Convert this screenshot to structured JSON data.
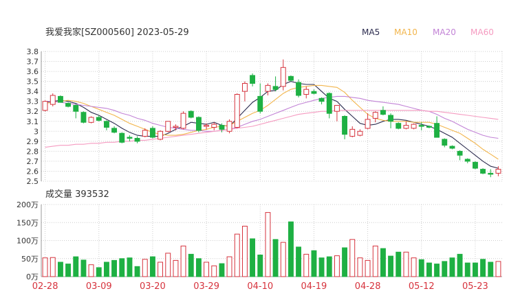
{
  "chart_data": {
    "type": "candlestick",
    "title": "我爱我家[SZ000560] 2023-05-29",
    "legend": [
      {
        "name": "MA5",
        "color": "#2b2b4e"
      },
      {
        "name": "MA10",
        "color": "#f2b54c"
      },
      {
        "name": "MA20",
        "color": "#c283d6"
      },
      {
        "name": "MA60",
        "color": "#f59ac0"
      }
    ],
    "colors": {
      "up": "#d6323c",
      "down": "#1eb043",
      "grid": "#cccccc",
      "axis": "#999999"
    },
    "price_axis": {
      "ylim": [
        2.5,
        3.8
      ],
      "ticks": [
        "3.8",
        "3.7",
        "3.6",
        "3.5",
        "3.4",
        "3.3",
        "3.2",
        "3.1",
        "3",
        "2.9",
        "2.8",
        "2.7",
        "2.6",
        "2.5"
      ]
    },
    "volume_panel": {
      "label": "成交量 393532",
      "ylim": [
        0,
        200
      ],
      "ticks": [
        "200万",
        "150万",
        "100万",
        "50万",
        "0万"
      ]
    },
    "x_ticks": [
      {
        "label": "02-28",
        "index": 0
      },
      {
        "label": "03-09",
        "index": 7
      },
      {
        "label": "03-20",
        "index": 14
      },
      {
        "label": "03-29",
        "index": 21
      },
      {
        "label": "04-10",
        "index": 28
      },
      {
        "label": "04-19",
        "index": 35
      },
      {
        "label": "04-28",
        "index": 42
      },
      {
        "label": "05-12",
        "index": 49
      },
      {
        "label": "05-23",
        "index": 56
      }
    ],
    "ohlc": [
      [
        3.21,
        3.31,
        3.2,
        3.3
      ],
      [
        3.27,
        3.38,
        3.25,
        3.36
      ],
      [
        3.35,
        3.36,
        3.29,
        3.29
      ],
      [
        3.28,
        3.29,
        3.24,
        3.25
      ],
      [
        3.26,
        3.27,
        3.13,
        3.2
      ],
      [
        3.19,
        3.2,
        3.08,
        3.09
      ],
      [
        3.09,
        3.15,
        3.08,
        3.14
      ],
      [
        3.14,
        3.16,
        3.1,
        3.11
      ],
      [
        3.1,
        3.11,
        3.01,
        3.04
      ],
      [
        3.03,
        3.05,
        2.98,
        2.99
      ],
      [
        2.98,
        2.99,
        2.88,
        2.89
      ],
      [
        2.94,
        2.96,
        2.9,
        2.93
      ],
      [
        2.93,
        2.95,
        2.88,
        2.9
      ],
      [
        2.95,
        3.03,
        2.94,
        3.01
      ],
      [
        3.03,
        3.05,
        2.93,
        2.94
      ],
      [
        2.92,
        3.01,
        2.91,
        3.0
      ],
      [
        3.0,
        3.1,
        2.99,
        3.1
      ],
      [
        3.04,
        3.07,
        3.01,
        3.05
      ],
      [
        3.03,
        3.2,
        3.02,
        3.18
      ],
      [
        3.2,
        3.21,
        3.13,
        3.14
      ],
      [
        3.14,
        3.15,
        2.99,
        3.01
      ],
      [
        3.05,
        3.08,
        3.02,
        3.06
      ],
      [
        3.04,
        3.09,
        3.01,
        3.07
      ],
      [
        3.06,
        3.08,
        2.99,
        3.02
      ],
      [
        3.0,
        3.12,
        2.98,
        3.1
      ],
      [
        3.04,
        3.38,
        3.03,
        3.37
      ],
      [
        3.4,
        3.5,
        3.3,
        3.48
      ],
      [
        3.56,
        3.58,
        3.45,
        3.48
      ],
      [
        3.35,
        3.48,
        3.18,
        3.2
      ],
      [
        3.4,
        3.48,
        3.36,
        3.46
      ],
      [
        3.45,
        3.55,
        3.4,
        3.42
      ],
      [
        3.45,
        3.72,
        3.41,
        3.64
      ],
      [
        3.55,
        3.56,
        3.5,
        3.51
      ],
      [
        3.49,
        3.52,
        3.34,
        3.36
      ],
      [
        3.37,
        3.45,
        3.33,
        3.42
      ],
      [
        3.4,
        3.42,
        3.37,
        3.38
      ],
      [
        3.33,
        3.34,
        3.27,
        3.3
      ],
      [
        3.38,
        3.39,
        3.13,
        3.18
      ],
      [
        3.2,
        3.26,
        3.1,
        3.26
      ],
      [
        3.15,
        3.16,
        2.92,
        2.97
      ],
      [
        2.95,
        3.05,
        2.94,
        3.02
      ],
      [
        2.96,
        3.02,
        2.95,
        3.0
      ],
      [
        3.03,
        3.18,
        3.02,
        3.12
      ],
      [
        3.13,
        3.2,
        3.09,
        3.19
      ],
      [
        3.21,
        3.25,
        3.16,
        3.17
      ],
      [
        3.16,
        3.18,
        3.03,
        3.1
      ],
      [
        3.08,
        3.09,
        3.02,
        3.03
      ],
      [
        3.03,
        3.1,
        3.02,
        3.06
      ],
      [
        3.03,
        3.08,
        3.02,
        3.07
      ],
      [
        3.06,
        3.09,
        3.01,
        3.05
      ],
      [
        3.05,
        3.06,
        3.03,
        3.04
      ],
      [
        3.08,
        3.15,
        2.94,
        2.94
      ],
      [
        2.92,
        2.93,
        2.84,
        2.86
      ],
      [
        2.85,
        2.86,
        2.82,
        2.83
      ],
      [
        2.8,
        2.81,
        2.71,
        2.76
      ],
      [
        2.72,
        2.73,
        2.68,
        2.7
      ],
      [
        2.69,
        2.7,
        2.62,
        2.63
      ],
      [
        2.62,
        2.63,
        2.57,
        2.58
      ],
      [
        2.58,
        2.62,
        2.54,
        2.57
      ],
      [
        2.58,
        2.65,
        2.55,
        2.62
      ]
    ],
    "ma5": [
      3.29,
      3.3,
      3.31,
      3.3,
      3.28,
      3.24,
      3.19,
      3.16,
      3.12,
      3.08,
      3.03,
      2.99,
      2.96,
      2.95,
      2.95,
      2.95,
      2.98,
      3.02,
      3.05,
      3.09,
      3.08,
      3.07,
      3.09,
      3.06,
      3.05,
      3.13,
      3.21,
      3.29,
      3.34,
      3.4,
      3.41,
      3.47,
      3.5,
      3.48,
      3.47,
      3.47,
      3.4,
      3.33,
      3.3,
      3.22,
      3.15,
      3.08,
      3.06,
      3.07,
      3.1,
      3.12,
      3.12,
      3.11,
      3.09,
      3.07,
      3.05,
      3.02,
      2.98,
      2.94,
      2.88,
      2.82,
      2.76,
      2.7,
      2.65,
      2.63
    ],
    "ma10": [
      3.28,
      3.29,
      3.3,
      3.31,
      3.3,
      3.28,
      3.25,
      3.22,
      3.19,
      3.16,
      3.12,
      3.08,
      3.05,
      3.02,
      2.99,
      2.97,
      2.96,
      2.96,
      2.97,
      2.99,
      3.01,
      3.02,
      3.04,
      3.05,
      3.06,
      3.1,
      3.14,
      3.18,
      3.21,
      3.26,
      3.32,
      3.38,
      3.42,
      3.44,
      3.45,
      3.46,
      3.46,
      3.45,
      3.44,
      3.39,
      3.31,
      3.24,
      3.17,
      3.13,
      3.11,
      3.1,
      3.1,
      3.1,
      3.09,
      3.09,
      3.09,
      3.07,
      3.04,
      3.01,
      2.98,
      2.93,
      2.88,
      2.82,
      2.77,
      2.72
    ],
    "ma20": [
      3.3,
      3.3,
      3.29,
      3.28,
      3.27,
      3.26,
      3.25,
      3.24,
      3.23,
      3.21,
      3.18,
      3.16,
      3.13,
      3.11,
      3.08,
      3.06,
      3.04,
      3.03,
      3.02,
      3.01,
      3.01,
      3.0,
      3.0,
      3.01,
      3.02,
      3.04,
      3.07,
      3.1,
      3.12,
      3.15,
      3.18,
      3.21,
      3.24,
      3.27,
      3.29,
      3.31,
      3.33,
      3.34,
      3.35,
      3.35,
      3.34,
      3.33,
      3.31,
      3.3,
      3.29,
      3.28,
      3.27,
      3.25,
      3.23,
      3.21,
      3.2,
      3.17,
      3.13,
      3.1,
      3.06,
      3.02,
      2.99,
      2.96,
      2.94,
      2.93
    ],
    "ma60": [
      2.84,
      2.85,
      2.86,
      2.86,
      2.87,
      2.87,
      2.88,
      2.88,
      2.89,
      2.89,
      2.9,
      2.9,
      2.91,
      2.91,
      2.92,
      2.93,
      2.94,
      2.95,
      2.96,
      2.97,
      2.98,
      2.99,
      3.0,
      3.01,
      3.02,
      3.03,
      3.04,
      3.05,
      3.07,
      3.09,
      3.11,
      3.13,
      3.15,
      3.17,
      3.18,
      3.19,
      3.2,
      3.2,
      3.21,
      3.21,
      3.21,
      3.21,
      3.21,
      3.21,
      3.21,
      3.21,
      3.21,
      3.21,
      3.21,
      3.21,
      3.2,
      3.2,
      3.19,
      3.18,
      3.17,
      3.16,
      3.15,
      3.14,
      3.13,
      3.12
    ],
    "volume": [
      52,
      53,
      40,
      35,
      55,
      46,
      33,
      25,
      40,
      45,
      50,
      52,
      28,
      48,
      55,
      40,
      65,
      45,
      85,
      62,
      50,
      40,
      30,
      36,
      55,
      118,
      140,
      105,
      60,
      178,
      103,
      95,
      152,
      82,
      62,
      72,
      52,
      55,
      58,
      80,
      103,
      52,
      45,
      85,
      78,
      57,
      68,
      68,
      52,
      47,
      38,
      35,
      42,
      52,
      62,
      38,
      38,
      48,
      40,
      42,
      43
    ]
  }
}
